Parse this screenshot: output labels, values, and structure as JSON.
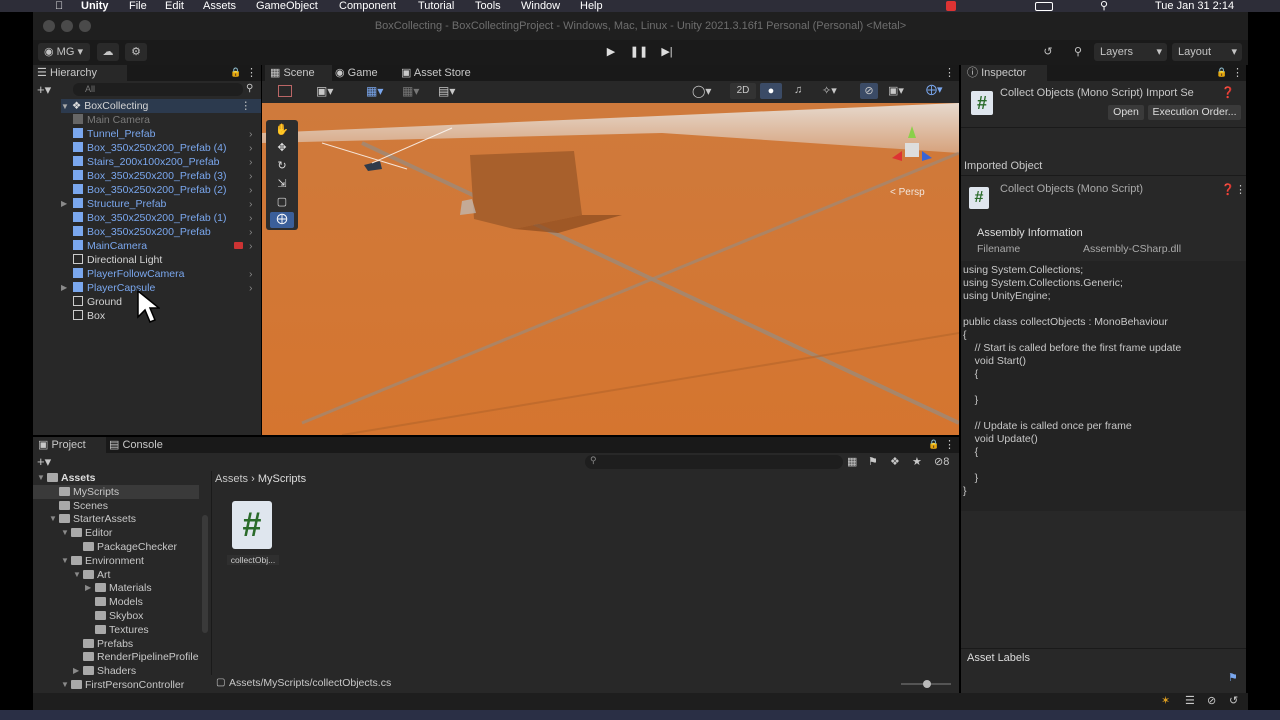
{
  "mac_menubar": {
    "app_name": "Unity",
    "menus": [
      "File",
      "Edit",
      "Assets",
      "GameObject",
      "Component",
      "Tutorial",
      "Tools",
      "Window",
      "Help"
    ],
    "clock": "Tue Jan 31  2:14"
  },
  "window_title": "BoxCollecting - BoxCollectingProject - Windows, Mac, Linux - Unity 2021.3.16f1 Personal (Personal) <Metal>",
  "toolbar": {
    "account_label": "MG",
    "layers_label": "Layers",
    "layout_label": "Layout"
  },
  "hierarchy": {
    "tab_label": "Hierarchy",
    "search_placeholder": "All",
    "scene_name": "BoxCollecting",
    "items": [
      {
        "label": "Main Camera",
        "style": "gray"
      },
      {
        "label": "Tunnel_Prefab",
        "style": "blue"
      },
      {
        "label": "Box_350x250x200_Prefab (4)",
        "style": "blue"
      },
      {
        "label": "Stairs_200x100x200_Prefab",
        "style": "blue"
      },
      {
        "label": "Box_350x250x200_Prefab (3)",
        "style": "blue"
      },
      {
        "label": "Box_350x250x200_Prefab (2)",
        "style": "blue"
      },
      {
        "label": "Structure_Prefab",
        "style": "blue"
      },
      {
        "label": "Box_350x250x200_Prefab (1)",
        "style": "blue"
      },
      {
        "label": "Box_350x250x200_Prefab",
        "style": "blue"
      },
      {
        "label": "MainCamera",
        "style": "blue"
      },
      {
        "label": "Directional Light",
        "style": "white"
      },
      {
        "label": "PlayerFollowCamera",
        "style": "blue"
      },
      {
        "label": "PlayerCapsule",
        "style": "blue"
      },
      {
        "label": "Ground",
        "style": "white"
      },
      {
        "label": "Box",
        "style": "white"
      }
    ]
  },
  "scene_tabs": {
    "scene": "Scene",
    "game": "Game",
    "asset_store": "Asset Store",
    "mode_2d": "2D",
    "persp_label": "< Persp"
  },
  "inspector": {
    "tab_label": "Inspector",
    "header_title": "Collect Objects (Mono Script) Import Se",
    "open_button": "Open",
    "execution_order_button": "Execution Order...",
    "imported_object_label": "Imported Object",
    "script_title": "Collect Objects (Mono Script)",
    "assembly_info_label": "Assembly Information",
    "filename_label": "Filename",
    "filename_value": "Assembly-CSharp.dll",
    "code_lines": [
      "using System.Collections;",
      "using System.Collections.Generic;",
      "using UnityEngine;",
      "",
      "public class collectObjects : MonoBehaviour",
      "{",
      "    // Start is called before the first frame update",
      "    void Start()",
      "    {",
      "",
      "    }",
      "",
      "    // Update is called once per frame",
      "    void Update()",
      "    {",
      "",
      "    }",
      "}"
    ],
    "asset_labels": "Asset Labels"
  },
  "project": {
    "project_tab": "Project",
    "console_tab": "Console",
    "hidden_count": "8",
    "tree": [
      {
        "label": "Assets",
        "indent": 0,
        "arrow": "down",
        "bold": true
      },
      {
        "label": "MyScripts",
        "indent": 1,
        "arrow": "",
        "selected": true
      },
      {
        "label": "Scenes",
        "indent": 1,
        "arrow": ""
      },
      {
        "label": "StarterAssets",
        "indent": 1,
        "arrow": "down"
      },
      {
        "label": "Editor",
        "indent": 2,
        "arrow": "down"
      },
      {
        "label": "PackageChecker",
        "indent": 3,
        "arrow": ""
      },
      {
        "label": "Environment",
        "indent": 2,
        "arrow": "down"
      },
      {
        "label": "Art",
        "indent": 3,
        "arrow": "down"
      },
      {
        "label": "Materials",
        "indent": 4,
        "arrow": "right"
      },
      {
        "label": "Models",
        "indent": 4,
        "arrow": ""
      },
      {
        "label": "Skybox",
        "indent": 4,
        "arrow": ""
      },
      {
        "label": "Textures",
        "indent": 4,
        "arrow": ""
      },
      {
        "label": "Prefabs",
        "indent": 3,
        "arrow": ""
      },
      {
        "label": "RenderPipelineProfile",
        "indent": 3,
        "arrow": ""
      },
      {
        "label": "Shaders",
        "indent": 3,
        "arrow": "right"
      },
      {
        "label": "FirstPersonController",
        "indent": 2,
        "arrow": "down"
      }
    ],
    "breadcrumb_root": "Assets",
    "breadcrumb_current": "MyScripts",
    "file_label": "collectObj...",
    "footer_path": "Assets/MyScripts/collectObjects.cs"
  },
  "colors": {
    "ground": "#d2752e",
    "sky": "#e8e0d8",
    "box": "#a8602c",
    "accent_blue": "#7aa7ee",
    "script_icon": "#dfe6ee"
  }
}
